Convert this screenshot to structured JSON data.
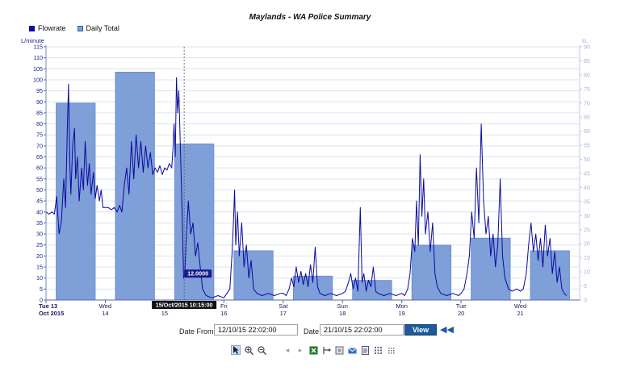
{
  "chart_data": {
    "type": "bar+line",
    "title": "Maylands - WA Police Summary",
    "y_left_label": "L/minute",
    "y_right_label": "kL",
    "y_left_range": [
      0,
      115
    ],
    "y_left_ticks": [
      0,
      5,
      10,
      15,
      20,
      25,
      30,
      35,
      40,
      45,
      50,
      55,
      60,
      65,
      70,
      75,
      80,
      85,
      90,
      95,
      100,
      105,
      110,
      115
    ],
    "y_right_range": [
      0,
      90
    ],
    "y_right_ticks": [
      0,
      5,
      10,
      15,
      20,
      25,
      30,
      35,
      40,
      45,
      50,
      55,
      60,
      65,
      70,
      75,
      80,
      85,
      90
    ],
    "x_day_labels": [
      {
        "day": "Tue 13",
        "sub": "Oct 2015"
      },
      {
        "day": "Wed",
        "sub": "14"
      },
      {
        "day": "Thu",
        "sub": "15"
      },
      {
        "day": "Fri",
        "sub": "16"
      },
      {
        "day": "Sat",
        "sub": "17"
      },
      {
        "day": "Sun",
        "sub": "18"
      },
      {
        "day": "Mon",
        "sub": "19"
      },
      {
        "day": "Tue",
        "sub": "20"
      },
      {
        "day": "Wed",
        "sub": "21"
      }
    ],
    "series": [
      {
        "name": "Daily Total",
        "axis": "right",
        "values": [
          70,
          81,
          55.5,
          17.5,
          8.5,
          7,
          19.5,
          22,
          17.5
        ]
      },
      {
        "name": "Flowrate",
        "axis": "left",
        "points": [
          [
            0.0,
            40
          ],
          [
            0.05,
            39
          ],
          [
            0.1,
            40
          ],
          [
            0.14,
            39
          ],
          [
            0.18,
            47
          ],
          [
            0.22,
            30
          ],
          [
            0.26,
            36
          ],
          [
            0.3,
            55
          ],
          [
            0.33,
            42
          ],
          [
            0.36,
            78
          ],
          [
            0.38,
            98
          ],
          [
            0.4,
            63
          ],
          [
            0.42,
            48
          ],
          [
            0.45,
            70
          ],
          [
            0.48,
            78
          ],
          [
            0.5,
            55
          ],
          [
            0.53,
            65
          ],
          [
            0.56,
            45
          ],
          [
            0.6,
            60
          ],
          [
            0.63,
            50
          ],
          [
            0.66,
            72
          ],
          [
            0.7,
            52
          ],
          [
            0.73,
            62
          ],
          [
            0.76,
            48
          ],
          [
            0.8,
            58
          ],
          [
            0.83,
            46
          ],
          [
            0.86,
            52
          ],
          [
            0.9,
            45
          ],
          [
            0.93,
            50
          ],
          [
            0.96,
            42
          ],
          [
            1.0,
            42
          ],
          [
            1.05,
            42
          ],
          [
            1.1,
            41
          ],
          [
            1.15,
            42
          ],
          [
            1.2,
            40
          ],
          [
            1.24,
            43
          ],
          [
            1.28,
            40
          ],
          [
            1.32,
            52
          ],
          [
            1.36,
            60
          ],
          [
            1.4,
            48
          ],
          [
            1.44,
            72
          ],
          [
            1.48,
            55
          ],
          [
            1.52,
            75
          ],
          [
            1.56,
            60
          ],
          [
            1.6,
            72
          ],
          [
            1.64,
            58
          ],
          [
            1.68,
            70
          ],
          [
            1.72,
            60
          ],
          [
            1.76,
            67
          ],
          [
            1.8,
            57
          ],
          [
            1.84,
            60
          ],
          [
            1.88,
            58
          ],
          [
            1.92,
            61
          ],
          [
            1.96,
            57
          ],
          [
            2.0,
            60
          ],
          [
            2.04,
            59
          ],
          [
            2.08,
            62
          ],
          [
            2.12,
            60
          ],
          [
            2.14,
            68
          ],
          [
            2.16,
            80
          ],
          [
            2.18,
            65
          ],
          [
            2.2,
            101
          ],
          [
            2.22,
            85
          ],
          [
            2.24,
            95
          ],
          [
            2.26,
            75
          ],
          [
            2.28,
            55
          ],
          [
            2.3,
            35
          ],
          [
            2.32,
            10
          ],
          [
            2.34,
            12
          ],
          [
            2.36,
            25
          ],
          [
            2.4,
            45
          ],
          [
            2.44,
            30
          ],
          [
            2.48,
            35
          ],
          [
            2.52,
            20
          ],
          [
            2.56,
            26
          ],
          [
            2.6,
            15
          ],
          [
            2.64,
            5
          ],
          [
            2.7,
            2
          ],
          [
            2.8,
            1
          ],
          [
            2.9,
            2
          ],
          [
            3.0,
            1
          ],
          [
            3.05,
            3
          ],
          [
            3.1,
            5
          ],
          [
            3.14,
            22
          ],
          [
            3.16,
            35
          ],
          [
            3.18,
            50
          ],
          [
            3.2,
            25
          ],
          [
            3.23,
            40
          ],
          [
            3.26,
            20
          ],
          [
            3.3,
            35
          ],
          [
            3.34,
            15
          ],
          [
            3.38,
            25
          ],
          [
            3.42,
            10
          ],
          [
            3.46,
            18
          ],
          [
            3.5,
            5
          ],
          [
            3.56,
            3
          ],
          [
            3.64,
            2
          ],
          [
            3.75,
            3
          ],
          [
            3.85,
            2
          ],
          [
            3.95,
            3
          ],
          [
            4.0,
            3
          ],
          [
            4.05,
            2
          ],
          [
            4.1,
            5
          ],
          [
            4.14,
            10
          ],
          [
            4.18,
            6
          ],
          [
            4.22,
            15
          ],
          [
            4.26,
            8
          ],
          [
            4.3,
            13
          ],
          [
            4.34,
            7
          ],
          [
            4.38,
            12
          ],
          [
            4.42,
            6
          ],
          [
            4.46,
            16
          ],
          [
            4.5,
            8
          ],
          [
            4.54,
            24
          ],
          [
            4.58,
            6
          ],
          [
            4.62,
            3
          ],
          [
            4.7,
            2
          ],
          [
            4.8,
            3
          ],
          [
            4.9,
            2
          ],
          [
            5.0,
            3
          ],
          [
            5.05,
            4
          ],
          [
            5.1,
            8
          ],
          [
            5.14,
            12
          ],
          [
            5.18,
            5
          ],
          [
            5.22,
            10
          ],
          [
            5.26,
            4
          ],
          [
            5.3,
            42
          ],
          [
            5.33,
            8
          ],
          [
            5.36,
            12
          ],
          [
            5.4,
            4
          ],
          [
            5.44,
            9
          ],
          [
            5.48,
            6
          ],
          [
            5.52,
            15
          ],
          [
            5.56,
            4
          ],
          [
            5.6,
            3
          ],
          [
            5.7,
            2
          ],
          [
            5.8,
            3
          ],
          [
            5.9,
            2
          ],
          [
            6.0,
            3
          ],
          [
            6.05,
            2
          ],
          [
            6.1,
            5
          ],
          [
            6.14,
            12
          ],
          [
            6.18,
            28
          ],
          [
            6.22,
            22
          ],
          [
            6.25,
            45
          ],
          [
            6.28,
            25
          ],
          [
            6.31,
            66
          ],
          [
            6.34,
            38
          ],
          [
            6.37,
            55
          ],
          [
            6.4,
            30
          ],
          [
            6.44,
            40
          ],
          [
            6.48,
            22
          ],
          [
            6.52,
            35
          ],
          [
            6.56,
            12
          ],
          [
            6.6,
            6
          ],
          [
            6.66,
            3
          ],
          [
            6.76,
            2
          ],
          [
            6.86,
            3
          ],
          [
            6.96,
            2
          ],
          [
            7.0,
            3
          ],
          [
            7.05,
            5
          ],
          [
            7.1,
            12
          ],
          [
            7.14,
            20
          ],
          [
            7.18,
            40
          ],
          [
            7.22,
            28
          ],
          [
            7.26,
            60
          ],
          [
            7.3,
            35
          ],
          [
            7.34,
            80
          ],
          [
            7.38,
            45
          ],
          [
            7.42,
            30
          ],
          [
            7.46,
            38
          ],
          [
            7.5,
            20
          ],
          [
            7.54,
            30
          ],
          [
            7.58,
            15
          ],
          [
            7.62,
            25
          ],
          [
            7.66,
            55
          ],
          [
            7.7,
            20
          ],
          [
            7.74,
            10
          ],
          [
            7.8,
            5
          ],
          [
            7.86,
            4
          ],
          [
            7.94,
            5
          ],
          [
            8.0,
            4
          ],
          [
            8.05,
            5
          ],
          [
            8.1,
            12
          ],
          [
            8.14,
            25
          ],
          [
            8.18,
            35
          ],
          [
            8.22,
            22
          ],
          [
            8.26,
            30
          ],
          [
            8.3,
            18
          ],
          [
            8.34,
            28
          ],
          [
            8.38,
            15
          ],
          [
            8.42,
            34
          ],
          [
            8.46,
            20
          ],
          [
            8.5,
            28
          ],
          [
            8.54,
            12
          ],
          [
            8.58,
            22
          ],
          [
            8.62,
            8
          ],
          [
            8.66,
            15
          ],
          [
            8.7,
            5
          ],
          [
            8.74,
            3
          ],
          [
            8.78,
            2
          ]
        ]
      }
    ],
    "tooltip": {
      "value": "12.0000",
      "x_day": 2.33,
      "y": 12
    },
    "crosshair_label": "15/Oct/2015 10:15:00",
    "legend_position": "top-left",
    "grid": true,
    "colors": {
      "bar": "#7f9fd9",
      "bar_edge": "#6a8bcb",
      "line": "#0a0a9e",
      "right_axis": "#a8b4d8",
      "left_axis": "#1a1a8a",
      "grid": "#dde3f0"
    }
  },
  "legend": {
    "flowrate": "Flowrate",
    "daily_total": "Daily Total"
  },
  "controls": {
    "date_from_label": "Date From:",
    "date_from_value": "12/10/15 22:02:00",
    "date_to_label": "Date To:",
    "date_to_value": "21/10/15 22:02:00",
    "view_button": "View",
    "rewind_icon": "rewind-icon"
  },
  "toolbar": {
    "icons": [
      "pointer-icon",
      "zoom-in-icon",
      "zoom-out-icon",
      "prev-icon",
      "next-icon",
      "excel-export-icon",
      "connector-icon",
      "print-preview-icon",
      "email-icon",
      "report-icon",
      "grid-icon",
      "grid-small-icon"
    ]
  }
}
